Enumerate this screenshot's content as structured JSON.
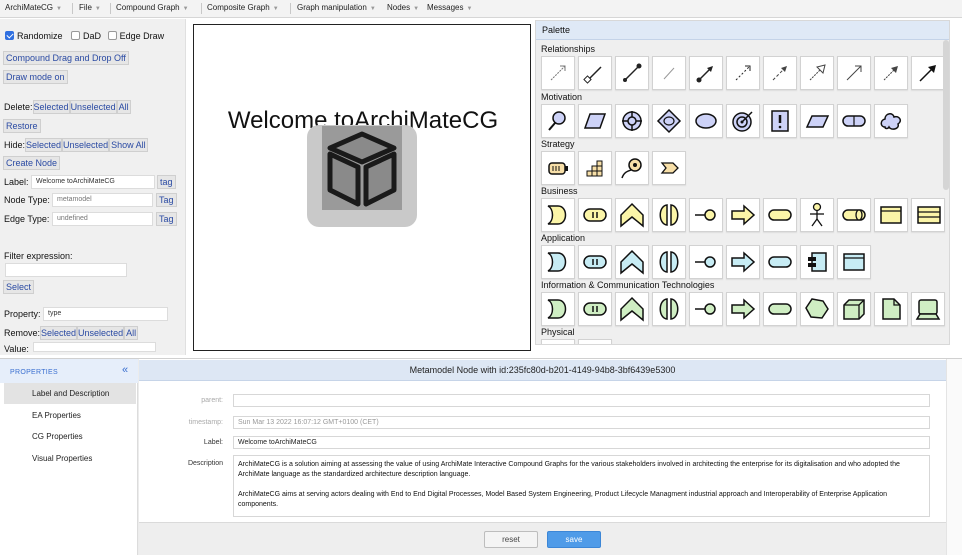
{
  "menubar": {
    "items": [
      "ArchiMateCG",
      "File",
      "Compound Graph",
      "Composite Graph",
      "Graph manipulation",
      "Nodes",
      "Messages"
    ]
  },
  "left_panel": {
    "randomize_label": "Randomize",
    "randomize_checked": true,
    "dad_label": "DaD",
    "dad_checked": false,
    "edge_draw_label": "Edge Draw",
    "edge_draw_checked": false,
    "compound_dnd_button": "Compound Drag and Drop Off",
    "draw_mode_button": "Draw mode on",
    "delete_label": "Delete:",
    "delete_selected": "Selected",
    "delete_unselected": "Unselected",
    "delete_all": "All",
    "restore_button": "Restore",
    "hide_label": "Hide:",
    "hide_selected": "Selected",
    "hide_unselected": "Unselected",
    "hide_show_all": "Show All",
    "create_node_button": "Create Node",
    "node_label_label": "Label:",
    "node_label_value": "Welcome toArchiMateCG",
    "node_label_tag": "tag",
    "node_type_label": "Node Type:",
    "node_type_value": "metamodel",
    "node_type_tag": "Tag",
    "edge_type_label": "Edge Type:",
    "edge_type_value": "undefined",
    "edge_type_tag": "Tag",
    "filter_label": "Filter expression:",
    "filter_value": "",
    "select_button": "Select",
    "property_label": "Property:",
    "property_value": "type",
    "remove_label": "Remove:",
    "remove_selected": "Selected",
    "remove_unselected": "Unselected",
    "remove_all": "All",
    "value_label": "Value:",
    "value_value": ""
  },
  "canvas": {
    "welcome_text": "Welcome toArchiMateCG"
  },
  "palette": {
    "title": "Palette",
    "sections": {
      "relationships": "Relationships",
      "motivation": "Motivation",
      "strategy": "Strategy",
      "business": "Business",
      "application": "Application",
      "ict": "Information & Communication Technologies",
      "physical": "Physical"
    },
    "colors": {
      "motivation": "#cdd2f7",
      "strategy": "#f7dfa8",
      "business": "#fbf5a8",
      "application": "#c7ecf4",
      "technology": "#cfeec3"
    }
  },
  "properties": {
    "nav_title": "PROPERTIES",
    "collapse_icon": "double-chevron-left",
    "nav_items": [
      "Label and Description",
      "EA Properties",
      "CG Properties",
      "Visual Properties"
    ],
    "header": "Metamodel Node with id:235fc80d-b201-4149-94b8-3bf6439e5300",
    "parent_label": "parent:",
    "parent_value": "",
    "timestamp_label": "timestamp:",
    "timestamp_value": "Sun Mar 13 2022 16:07:12 GMT+0100 (CET)",
    "label_label": "Label:",
    "label_value": "Welcome toArchiMateCG",
    "description_label": "Description",
    "description_p1": "ArchiMateCG is a solution aiming at assessing the value of using ArchiMate Interactive Compound Graphs for the various stakeholders involved in architecting the enterprise for its digitalisation and who adopted the ArchiMate language as the standardized architecture description language.",
    "description_p2": "ArchiMateCG aims at serving actors dealing with End to End Digital Processes, Model Based System Engineering, Product Lifecycle Managment industrial approach and Interoperability of Enterprise Application components.",
    "reset_button": "reset",
    "save_button": "save"
  }
}
